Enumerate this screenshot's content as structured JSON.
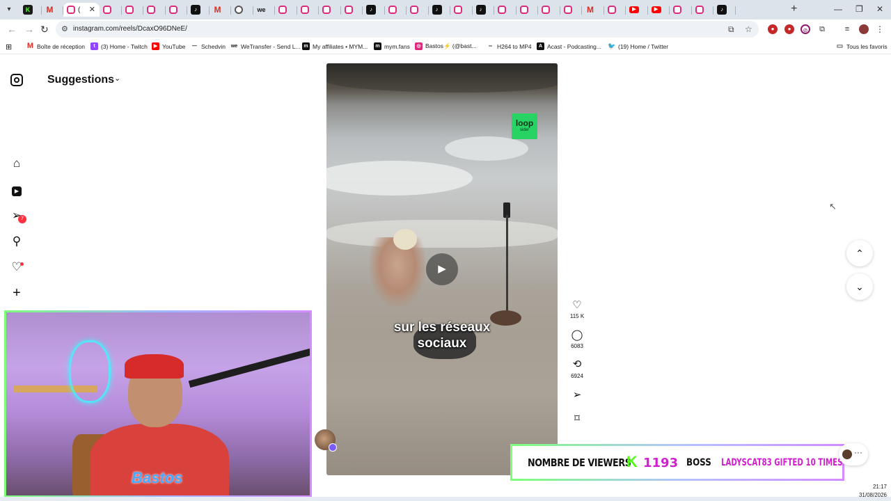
{
  "browser": {
    "url": "instagram.com/reels/DcaxO96DNeE/",
    "tabs": [
      "K",
      "M",
      "ig",
      "ig",
      "ig",
      "ig",
      "ig",
      "tt",
      "M",
      "gl",
      "we",
      "ig",
      "ig",
      "ig",
      "ig",
      "tt",
      "ig",
      "ig",
      "tt",
      "ig",
      "tt",
      "ig",
      "ig",
      "ig",
      "ig",
      "M",
      "ig",
      "yt",
      "yt",
      "ig",
      "ig",
      "tt"
    ],
    "active_tab_title": "(",
    "bookmarks": [
      {
        "label": "Boîte de réception",
        "icon": "gmail-icon"
      },
      {
        "label": "(3) Home - Twitch",
        "icon": "twitch-icon"
      },
      {
        "label": "YouTube",
        "icon": "youtube-icon"
      },
      {
        "label": "Schedvin",
        "icon": "dash-icon"
      },
      {
        "label": "WeTransfer - Send L...",
        "icon": "wetransfer-icon"
      },
      {
        "label": "My affiliates • MYM...",
        "icon": "mym-icon"
      },
      {
        "label": "mym.fans",
        "icon": "mym-icon"
      },
      {
        "label": "Bastos⚡ (@bast...",
        "icon": "instagram-icon"
      },
      {
        "label": "H264 to MP4",
        "icon": "link-icon"
      },
      {
        "label": "Acast - Podcasting...",
        "icon": "acast-icon"
      },
      {
        "label": "(19) Home / Twitter",
        "icon": "twitter-icon"
      }
    ],
    "all_bookmarks": "Tous les favoris"
  },
  "sidebar": {
    "title": "Suggestions",
    "notifications_badge": "7"
  },
  "reel": {
    "caption_line1": "sur les réseaux",
    "caption_line2": "sociaux",
    "brand_logo": "loop",
    "brand_logo_sub": "sider",
    "likes": "115 K",
    "comments": "6083",
    "reposts": "6924"
  },
  "overlay": {
    "viewers_label": "NOMBRE DE VIEWERS",
    "kick_glyph": "K",
    "viewers_count": "1193",
    "boss_label": "BOSS",
    "gift_text": "LADYSCAT83 GIFTED 10 TIMES",
    "webcam_logo": "Bastos"
  },
  "system": {
    "time": "21:17",
    "date": "31/08/2026"
  },
  "colors": {
    "kick_green": "#53fc18",
    "alert_magenta": "#d21fcf",
    "instagram_red": "#ff3040"
  }
}
